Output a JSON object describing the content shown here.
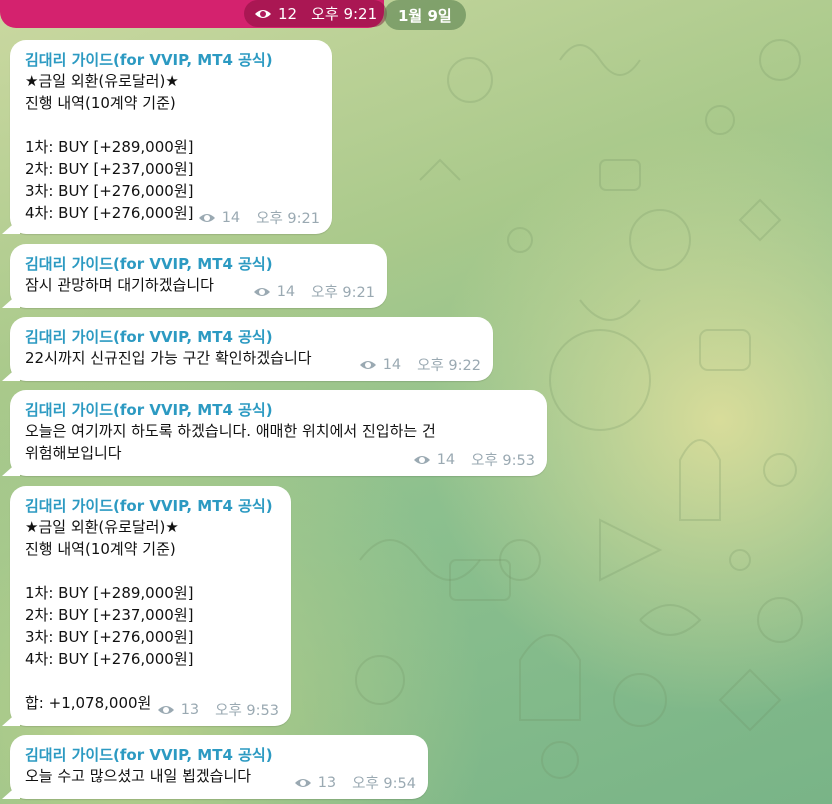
{
  "top": {
    "views": "12",
    "time": "오후 9:21",
    "date": "1월 9일"
  },
  "messages": [
    {
      "sender": "김대리 가이드(for VVIP, MT4 공식)",
      "text": "★금일 외환(유로달러)★\n진행 내역(10계약 기준)\n\n1차: BUY [+289,000원]\n2차: BUY [+237,000원]\n3차: BUY [+276,000원]\n4차: BUY [+276,000원]",
      "views": "14",
      "time": "오후 9:21"
    },
    {
      "sender": "김대리 가이드(for VVIP, MT4 공식)",
      "text": "잠시 관망하며 대기하겠습니다",
      "views": "14",
      "time": "오후 9:21"
    },
    {
      "sender": "김대리 가이드(for VVIP, MT4 공식)",
      "text": "22시까지 신규진입 가능 구간 확인하겠습니다",
      "views": "14",
      "time": "오후 9:22"
    },
    {
      "sender": "김대리 가이드(for VVIP, MT4 공식)",
      "text": "오늘은 여기까지 하도록 하겠습니다. 애매한 위치에서 진입하는 건\n위험해보입니다",
      "views": "14",
      "time": "오후 9:53"
    },
    {
      "sender": "김대리 가이드(for VVIP, MT4 공식)",
      "text": "★금일 외환(유로달러)★\n진행 내역(10계약 기준)\n\n1차: BUY [+289,000원]\n2차: BUY [+237,000원]\n3차: BUY [+276,000원]\n4차: BUY [+276,000원]\n\n합: +1,078,000원",
      "views": "13",
      "time": "오후 9:53"
    },
    {
      "sender": "김대리 가이드(for VVIP, MT4 공식)",
      "text": "오늘 수고 많으셨고 내일 뵙겠습니다",
      "views": "13",
      "time": "오후 9:54"
    }
  ],
  "colors": {
    "sender": "#2c9ac2",
    "top_bubble": "#d4226e",
    "meta": "#9aa9b2"
  }
}
